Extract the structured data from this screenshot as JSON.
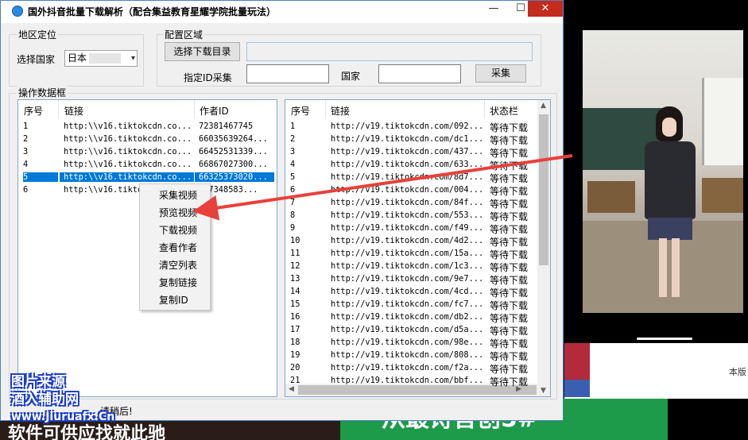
{
  "window": {
    "title": "国外抖音批量下载解析（配合集益教育星耀学院批量玩法）",
    "min_glyph": "—",
    "max_glyph": "☐",
    "close_glyph": "✕"
  },
  "region": {
    "group_label": "地区定位",
    "country_label": "选择国家",
    "country_value": "日本",
    "dropdown_glyph": "▾"
  },
  "config": {
    "group_label": "配置区域",
    "choose_dir_button": "选择下载目录",
    "dir_path": "",
    "author_id_label": "指定ID采集",
    "author_id_value": "",
    "country_label": "国家",
    "country_value": "",
    "collect_button": "采集"
  },
  "data_frame_label": "操作数据框",
  "left_table": {
    "columns": [
      "序号",
      "链接",
      "作者ID"
    ],
    "rows": [
      {
        "no": "1",
        "link": "http:\\\\v16.tiktokcdn.co...",
        "author": "72381467745"
      },
      {
        "no": "2",
        "link": "http:\\\\v16.tiktokcdn.co...",
        "author": "66035639264..."
      },
      {
        "no": "3",
        "link": "http:\\\\v16.tiktokcdn.co...",
        "author": "66452531339..."
      },
      {
        "no": "4",
        "link": "http:\\\\v16.tiktokcdn.co...",
        "author": "66867027300..."
      },
      {
        "no": "5",
        "link": "http:\\\\v16.tiktokcdn.co...",
        "author": "66325373020..."
      },
      {
        "no": "6",
        "link": "http:\\\\v16.tikto",
        "author": "337348583..."
      }
    ],
    "selected_index": 4
  },
  "context_menu": {
    "items": [
      "采集视频",
      "预览视频",
      "下载视频",
      "查看作者",
      "清空列表",
      "复制链接",
      "复制ID"
    ]
  },
  "right_table": {
    "columns": [
      "序号",
      "链接",
      "状态栏"
    ],
    "rows": [
      {
        "no": "1",
        "link": "http://v19.tiktokcdn.com/092...",
        "status": "等待下载"
      },
      {
        "no": "2",
        "link": "http://v19.tiktokcdn.com/dc1...",
        "status": "等待下载"
      },
      {
        "no": "3",
        "link": "http://v19.tiktokcdn.com/437...",
        "status": "等待下载"
      },
      {
        "no": "4",
        "link": "http://v19.tiktokcdn.com/633...",
        "status": "等待下载"
      },
      {
        "no": "5",
        "link": "http://v19.tiktokcdn.com/8d7...",
        "status": "等待下载"
      },
      {
        "no": "6",
        "link": "http://v19.tiktokcdn.com/004...",
        "status": "等待下载"
      },
      {
        "no": "7",
        "link": "http://v19.tiktokcdn.com/84f...",
        "status": "等待下载"
      },
      {
        "no": "8",
        "link": "http://v19.tiktokcdn.com/553...",
        "status": "等待下载"
      },
      {
        "no": "9",
        "link": "http://v19.tiktokcdn.com/f49...",
        "status": "等待下载"
      },
      {
        "no": "10",
        "link": "http://v19.tiktokcdn.com/4d2...",
        "status": "等待下载"
      },
      {
        "no": "11",
        "link": "http://v19.tiktokcdn.com/15a...",
        "status": "等待下载"
      },
      {
        "no": "12",
        "link": "http://v19.tiktokcdn.com/1c3...",
        "status": "等待下载"
      },
      {
        "no": "13",
        "link": "http://v19.tiktokcdn.com/9e7...",
        "status": "等待下载"
      },
      {
        "no": "14",
        "link": "http://v19.tiktokcdn.com/4cd...",
        "status": "等待下载"
      },
      {
        "no": "15",
        "link": "http://v19.tiktokcdn.com/fc7...",
        "status": "等待下载"
      },
      {
        "no": "16",
        "link": "http://v19.tiktokcdn.com/db2...",
        "status": "等待下载"
      },
      {
        "no": "17",
        "link": "http://v19.tiktokcdn.com/d5a...",
        "status": "等待下载"
      },
      {
        "no": "18",
        "link": "http://v19.tiktokcdn.com/98e...",
        "status": "等待下载"
      },
      {
        "no": "19",
        "link": "http://v19.tiktokcdn.com/808...",
        "status": "等待下载"
      },
      {
        "no": "20",
        "link": "http://v19.tiktokcdn.com/f2a...",
        "status": "等待下载"
      },
      {
        "no": "21",
        "link": "http://v19.tiktokcdn.com/bbf...",
        "status": "等待下载"
      }
    ]
  },
  "status_bar": {
    "text": "请稍后!"
  },
  "watermark": {
    "line1": "图片来源",
    "line2": "酒入辅助网",
    "line3": "www.Jiuruafx.Cn"
  },
  "background": {
    "right_label": "本版",
    "green_banner": "从最诗言创5#",
    "bottom_banner": "软件可供应找就此驰"
  },
  "colors": {
    "selection": "#0078d7",
    "arrow": "#e8403a",
    "close_button": "#c42b1c",
    "list_border": "#82a6c7"
  }
}
